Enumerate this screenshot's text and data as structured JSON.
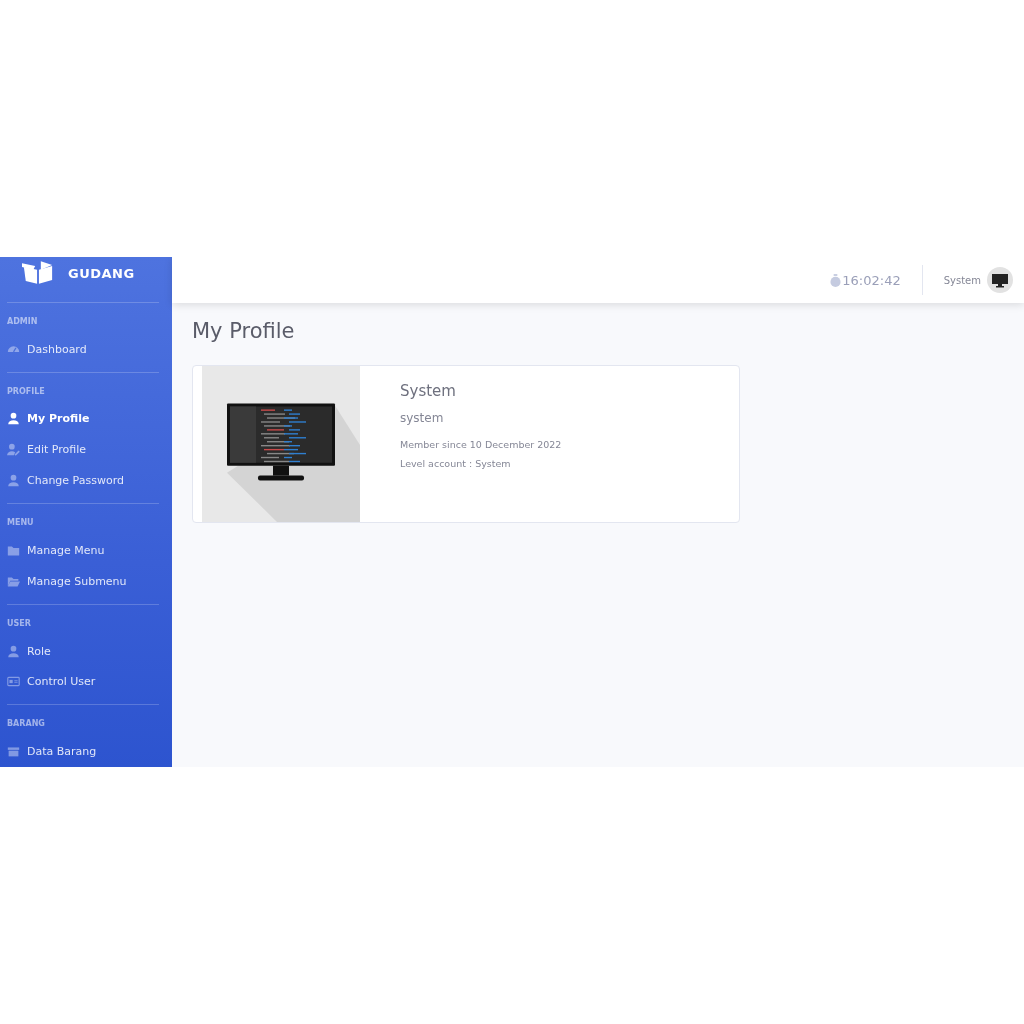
{
  "sidebar": {
    "brand": "GUDANG",
    "sections": [
      {
        "heading": "ADMIN",
        "items": [
          {
            "label": "Dashboard",
            "selected": false
          }
        ]
      },
      {
        "heading": "PROFILE",
        "items": [
          {
            "label": "My Profile",
            "selected": true
          },
          {
            "label": "Edit Profile",
            "selected": false
          },
          {
            "label": "Change Password",
            "selected": false
          }
        ]
      },
      {
        "heading": "MENU",
        "items": [
          {
            "label": "Manage Menu",
            "selected": false
          },
          {
            "label": "Manage Submenu",
            "selected": false
          }
        ]
      },
      {
        "heading": "USER",
        "items": [
          {
            "label": "Role",
            "selected": false
          },
          {
            "label": "Control User",
            "selected": false
          }
        ]
      },
      {
        "heading": "BARANG",
        "items": [
          {
            "label": "Data Barang",
            "selected": false
          }
        ]
      }
    ]
  },
  "topbar": {
    "clock": "16:02:42",
    "user_name": "System"
  },
  "page_title": "My Profile",
  "profile": {
    "name": "System",
    "username": "system",
    "member_since": "Member since 10 December 2022",
    "level": "Level account : System"
  }
}
